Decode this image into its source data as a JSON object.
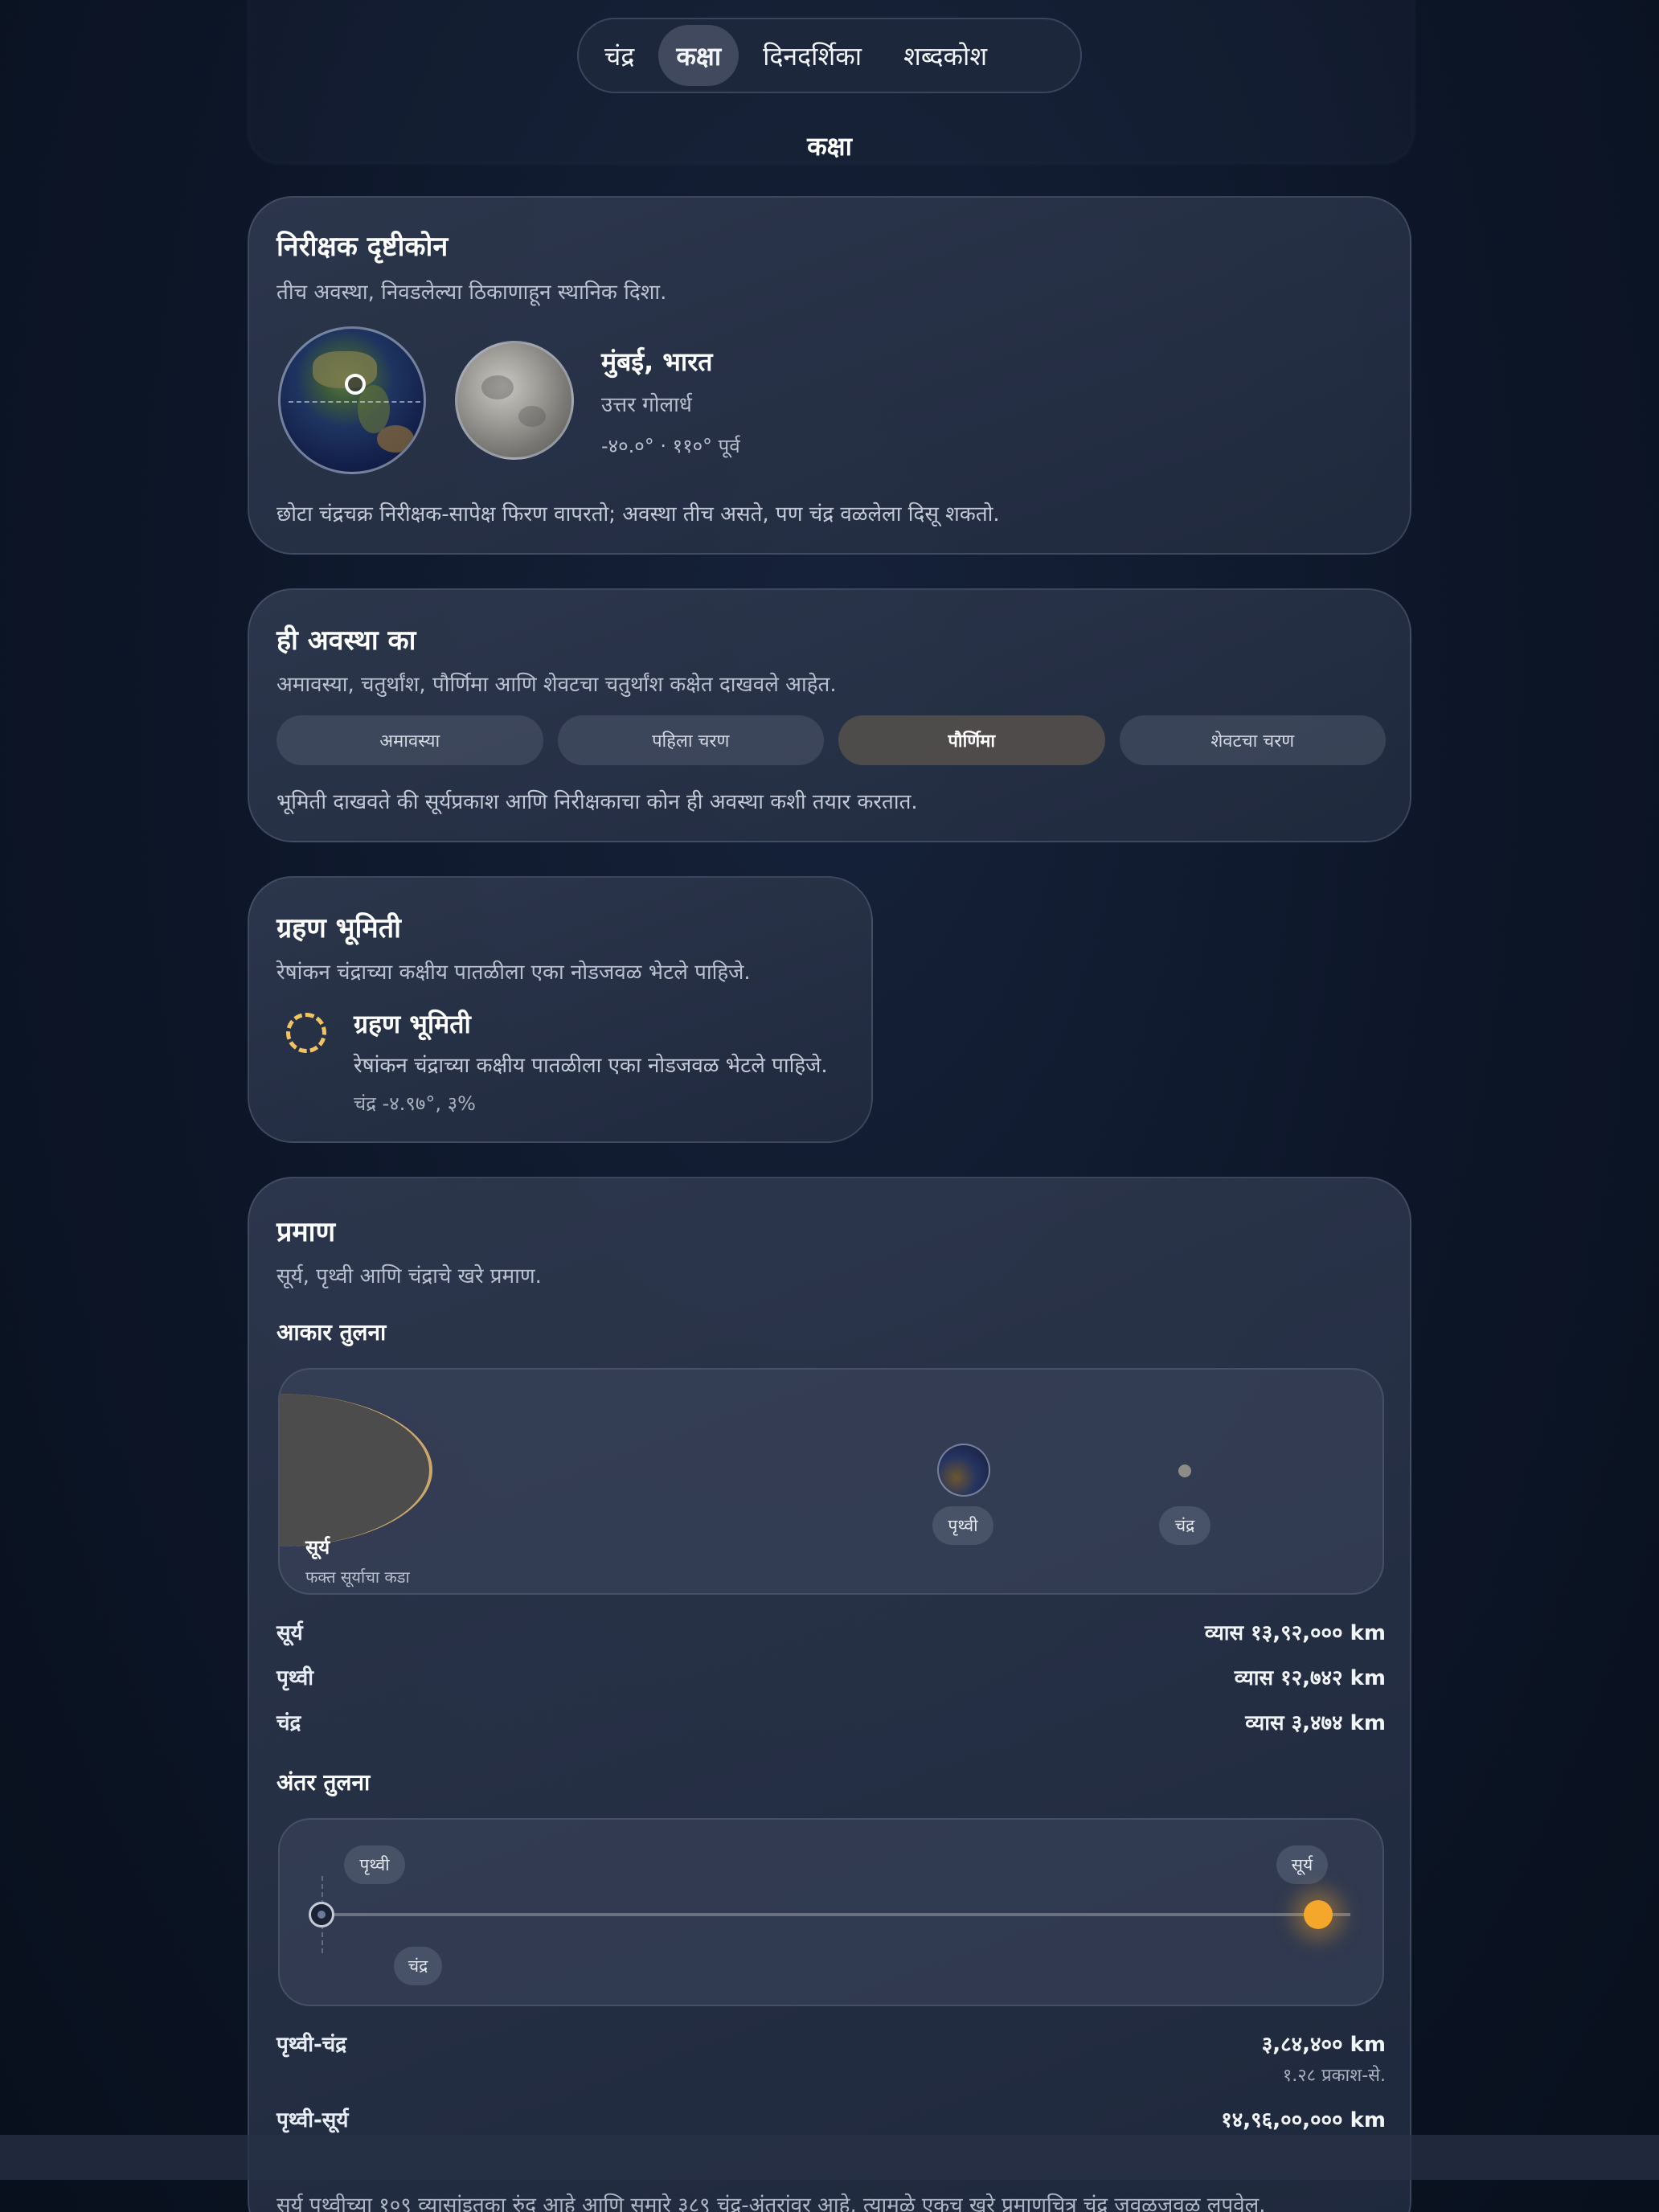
{
  "nav": {
    "tabs": [
      {
        "label": "चंद्र",
        "active": false
      },
      {
        "label": "कक्षा",
        "active": true
      },
      {
        "label": "दिनदर्शिका",
        "active": false
      },
      {
        "label": "शब्दकोश",
        "active": false
      }
    ]
  },
  "page_title": "कक्षा",
  "observer": {
    "title": "निरीक्षक दृष्टीकोन",
    "subtitle": "तीच अवस्था, निवडलेल्या ठिकाणाहून स्थानिक दिशा.",
    "location_name": "मुंबई, भारत",
    "hemisphere": "उत्तर गोलार्ध",
    "coordinates": "-४०.०° · ११०° पूर्व",
    "note": "छोटा चंद्रचक्र निरीक्षक-सापेक्ष फिरण वापरतो; अवस्था तीच असते, पण चंद्र वळलेला दिसू शकतो."
  },
  "phase_reason": {
    "title": "ही अवस्था का",
    "subtitle": "अमावस्या, चतुर्थांश, पौर्णिमा आणि शेवटचा चतुर्थांश कक्षेत दाखवले आहेत.",
    "phases": [
      "अमावस्या",
      "पहिला चरण",
      "पौर्णिमा",
      "शेवटचा चरण"
    ],
    "selected_phase": "पौर्णिमा",
    "note": "भूमिती दाखवते की सूर्यप्रकाश आणि निरीक्षकाचा कोन ही अवस्था कशी तयार करतात."
  },
  "eclipse": {
    "title": "ग्रहण भूमिती",
    "subtitle": "रेषांकन चंद्राच्या कक्षीय पातळीला एका नोडजवळ भेटले पाहिजे.",
    "item_title": "ग्रहण भूमिती",
    "item_desc": "रेषांकन चंद्राच्या कक्षीय पातळीला एका नोडजवळ भेटले पाहिजे.",
    "item_value": "चंद्र -४.९७°, ३%"
  },
  "scale": {
    "title": "प्रमाण",
    "subtitle": "सूर्य, पृथ्वी आणि चंद्राचे खरे प्रमाण.",
    "size_title": "आकार तुलना",
    "sun_label": "सूर्य",
    "sun_note": "फक्त सूर्याचा कडा",
    "earth_label": "पृथ्वी",
    "moon_label": "चंद्र",
    "diameters": [
      {
        "name": "सूर्य",
        "value": "व्यास १३,९२,००० km"
      },
      {
        "name": "पृथ्वी",
        "value": "व्यास १२,७४२ km"
      },
      {
        "name": "चंद्र",
        "value": "व्यास ३,४७४ km"
      }
    ],
    "distance_title": "अंतर तुलना",
    "dist_earth_label": "पृथ्वी",
    "dist_sun_label": "सूर्य",
    "dist_moon_label": "चंद्र",
    "distances": [
      {
        "name": "पृथ्वी-चंद्र",
        "value": "३,८४,४०० km",
        "secondary": "१.२८ प्रकाश-से."
      },
      {
        "name": "पृथ्वी-सूर्य",
        "value": "१४,९६,००,००० km"
      }
    ],
    "footer_text": "सूर्य पृथ्वीच्या १०९ व्यासांइतका रुंद आहे आणि समारे ३८९ चंद्र-अंतरांवर आहे, त्यामुळे एकच खरे प्रमाणचित्र चंद्र जवळजवळ लपवेल."
  },
  "colors": {
    "accent_gold": "#f2c461",
    "sun": "#f4a72a",
    "active_phase": "#5c564c"
  }
}
